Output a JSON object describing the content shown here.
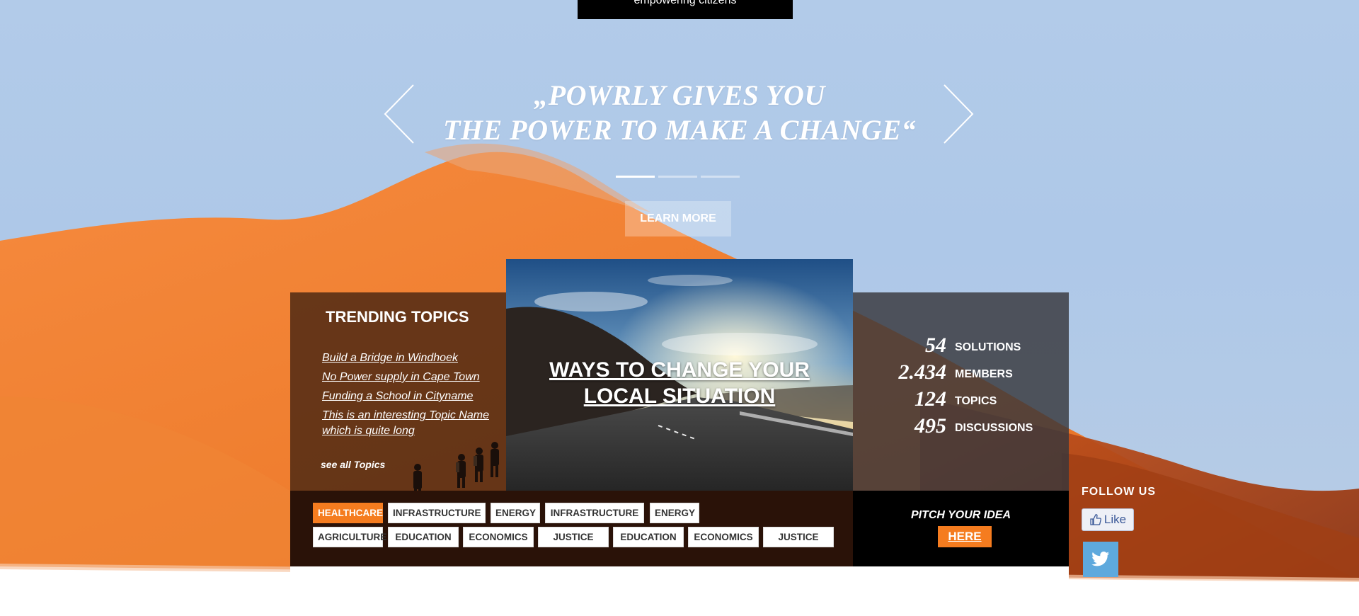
{
  "header": {
    "tagline": "empowering citizens"
  },
  "hero": {
    "quote_line1": "„POWRLY GIVES YOU",
    "quote_line2": "THE POWER TO MAKE A CHANGE“",
    "slide_count": 3,
    "active_slide": 1,
    "learn_more_label": "LEARN MORE"
  },
  "trending": {
    "title": "TRENDING TOPICS",
    "topics": [
      "Build a Bridge in Windhoek",
      "No Power supply in Cape Town",
      "Funding a School in Cityname",
      "This is an interesting Topic Name which is quite long"
    ],
    "see_all_label": "see all Topics"
  },
  "feature": {
    "title": "WAYS TO CHANGE YOUR LOCAL SITUATION"
  },
  "stats": [
    {
      "number": "54",
      "label": "SOLUTIONS"
    },
    {
      "number": "2.434",
      "label": "MEMBERS"
    },
    {
      "number": "124",
      "label": "TOPICS"
    },
    {
      "number": "495",
      "label": "DISCUSSIONS"
    }
  ],
  "tags": {
    "row1": [
      "HEALTHCARE",
      "INFRASTRUCTURE",
      "ENERGY",
      "INFRASTRUCTURE",
      "ENERGY"
    ],
    "row2": [
      "AGRICULTURE",
      "EDUCATION",
      "ECONOMICS",
      "JUSTICE",
      "EDUCATION",
      "ECONOMICS",
      "JUSTICE"
    ],
    "active": "HEALTHCARE"
  },
  "pitch": {
    "label": "PITCH YOUR IDEA",
    "button_label": "HERE"
  },
  "social": {
    "follow_label": "FOLLOW US",
    "facebook_label": "Like",
    "facebook_icon": "thumbs-up-icon",
    "twitter_icon": "twitter-bird-icon"
  },
  "colors": {
    "accent": "#f57c1f",
    "twitter": "#5ea9dd",
    "facebook": "#3b5998"
  }
}
